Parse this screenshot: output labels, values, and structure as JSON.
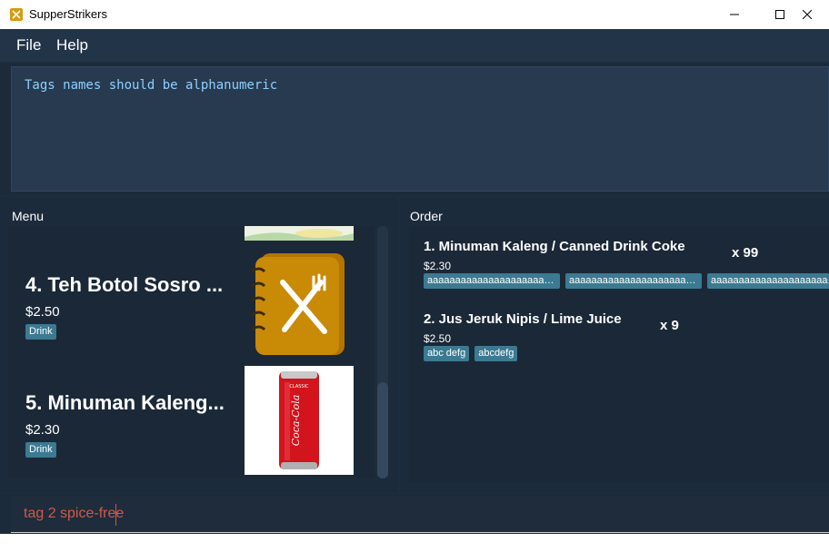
{
  "window": {
    "title": "SupperStrikers"
  },
  "menubar": {
    "items": [
      {
        "label": "File"
      },
      {
        "label": "Help"
      }
    ]
  },
  "result": {
    "text": "Tags names should be alphanumeric"
  },
  "menu_panel": {
    "heading": "Menu",
    "items": [
      {
        "title": "4.  Teh Botol Sosro ...",
        "price": "$2.50",
        "tags": [
          "Drink"
        ],
        "image_icon": "menu-book-icon"
      },
      {
        "title": "5.  Minuman Kaleng...",
        "price": "$2.30",
        "tags": [
          "Drink"
        ],
        "image_icon": "coca-cola-can-icon"
      }
    ],
    "cola_can": {
      "small": "CLASSIC",
      "brand": "Coca-Cola"
    }
  },
  "order_panel": {
    "heading": "Order",
    "items": [
      {
        "title": "1.  Minuman Kaleng / Canned Drink Coke",
        "quantity": "x 99",
        "price": "$2.30",
        "tags": [
          "aaaaaaaaaaaaaaaaaaaaaaaa...",
          "aaaaaaaaaaaaaaaaaaaaaaaa...",
          "aaaaaaaaaaaaaaaaaaaaaaaa..."
        ]
      },
      {
        "title": "2.  Jus Jeruk Nipis / Lime Juice",
        "quantity": "x 9",
        "price": "$2.50",
        "tags": [
          "abc defg",
          "abcdefg"
        ]
      }
    ]
  },
  "command": {
    "value": "tag 2 spice-free"
  },
  "colors": {
    "background": "#1d2d3d",
    "result_text": "#8fd0ff",
    "tag": "#3c7a91",
    "command_error_text": "#d05a4a",
    "icon_gold": "#c98a06"
  }
}
